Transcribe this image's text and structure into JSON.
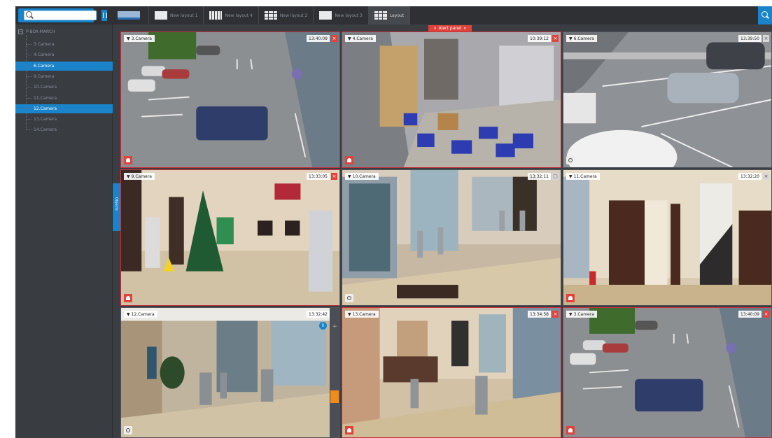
{
  "toolbar": {
    "search_placeholder": "",
    "layouts": [
      {
        "label": "",
        "kind": "blue"
      },
      {
        "label": "New layout 1",
        "kind": "plain"
      },
      {
        "label": "New layout 4",
        "kind": "dots"
      },
      {
        "label": "New layout 2",
        "kind": "grid"
      },
      {
        "label": "New layout 3",
        "kind": "plain"
      },
      {
        "label": "Layout",
        "kind": "grid",
        "active": true
      }
    ]
  },
  "sidebar": {
    "root_label": "P-BOX-MARCH",
    "items": [
      {
        "label": "3.Camera",
        "selected": false
      },
      {
        "label": "4.Camera",
        "selected": false
      },
      {
        "label": "6.Camera",
        "selected": true
      },
      {
        "label": "9.Camera",
        "selected": false
      },
      {
        "label": "10.Camera",
        "selected": false
      },
      {
        "label": "11.Camera",
        "selected": false
      },
      {
        "label": "12.Camera",
        "selected": true
      },
      {
        "label": "13.Camera",
        "selected": false
      },
      {
        "label": "14.Camera",
        "selected": false
      }
    ],
    "objects_tab": "Objects"
  },
  "alert_panel": {
    "label": "Alert panel",
    "left_arrow": "«",
    "right_arrow": "»"
  },
  "cameras": [
    {
      "name": "3.Camera",
      "time": "13:40:09",
      "alert": true,
      "button": "alarm",
      "close": "×",
      "scene": "lot"
    },
    {
      "name": "4.Camera",
      "time": "10:39:12",
      "alert": true,
      "button": "alarm",
      "close": "×",
      "scene": "warehouse"
    },
    {
      "name": "6.Camera",
      "time": "13:39:50",
      "alert": false,
      "button": "ptz",
      "close": "×",
      "scene": "street"
    },
    {
      "name": "9.Camera",
      "time": "13:33:05",
      "alert": true,
      "button": "alarm",
      "close": "×",
      "scene": "lobby"
    },
    {
      "name": "10.Camera",
      "time": "13:32:11",
      "alert": false,
      "button": "ptz",
      "close": "□",
      "scene": "entrance"
    },
    {
      "name": "11.Camera",
      "time": "13:32:20",
      "alert": false,
      "button": "alarm",
      "close": "×",
      "scene": "doors"
    },
    {
      "name": "12.Camera",
      "time": "13:32:42",
      "alert": false,
      "button": "ptz",
      "close": "□",
      "scene": "turnstile"
    },
    {
      "name": "13.Camera",
      "time": "13:34:58",
      "alert": true,
      "button": "alarm",
      "close": "×",
      "scene": "reception"
    },
    {
      "name": "3.Camera",
      "time": "13:40:09",
      "alert": true,
      "button": "alarm",
      "close": "×",
      "scene": "lot"
    }
  ],
  "colors": {
    "accent": "#1a83c9",
    "alert": "#e0433b",
    "background": "#3a3d42"
  },
  "icons": [
    "search-icon",
    "sidebar-toggle-icon",
    "global-search-icon",
    "alarm-icon",
    "ptz-icon",
    "close-icon",
    "info-icon",
    "zoom-icon"
  ]
}
